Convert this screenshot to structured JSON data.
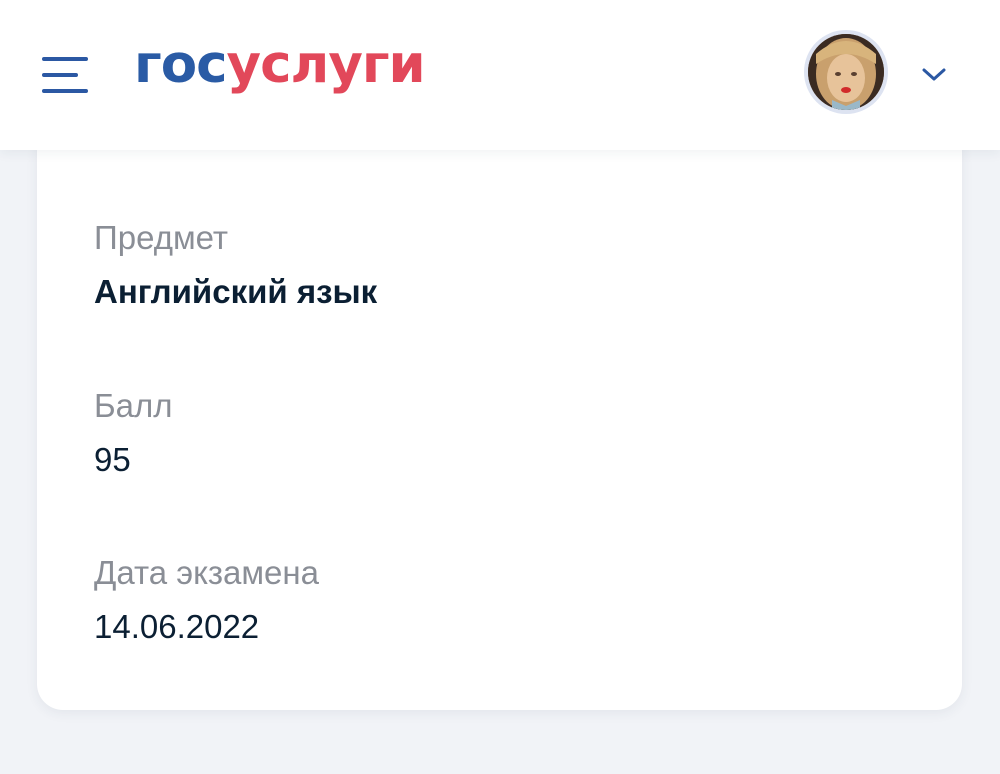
{
  "header": {
    "menu_icon": "hamburger-menu-icon",
    "logo": {
      "part1": "гос",
      "part2": "услуги",
      "color_part1": "#2a5ba5",
      "color_part2": "#e2485a"
    },
    "avatar_icon": "user-avatar",
    "dropdown_icon": "chevron-down-icon"
  },
  "card": {
    "fields": [
      {
        "label": "Предмет",
        "value": "Английский язык"
      },
      {
        "label": "Балл",
        "value": "95"
      },
      {
        "label": "Дата экзамена",
        "value": "14.06.2022"
      }
    ]
  },
  "colors": {
    "accent": "#2b58a3",
    "label_text": "#8a8e96",
    "value_text": "#0b1f33",
    "background": "#f1f3f7"
  }
}
